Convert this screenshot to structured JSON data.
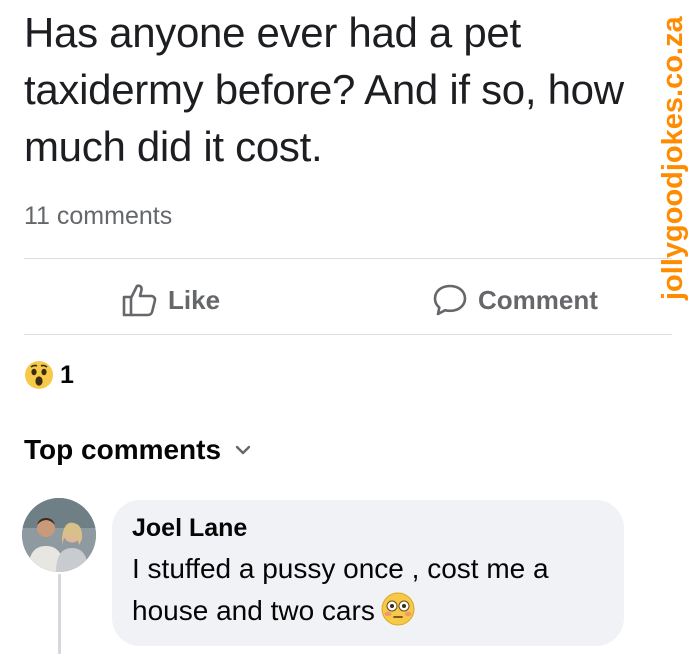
{
  "post": {
    "text": "Has anyone ever had a pet taxidermy before? And if so, how much did it cost.",
    "comments_count": "11 comments"
  },
  "actions": {
    "like_label": "Like",
    "comment_label": "Comment"
  },
  "reactions": {
    "count": "1",
    "emoji": "wow-face"
  },
  "comments_section": {
    "sort_label": "Top comments"
  },
  "comment": {
    "author": "Joel Lane",
    "text": "I stuffed a pussy once , cost me a house and two cars",
    "emoji": "flushed-face"
  },
  "watermark": {
    "text": "jollygoodjokes.co.za"
  },
  "colors": {
    "primary_text": "#050505",
    "secondary_text": "#65676b",
    "bubble_bg": "#f0f2f5",
    "watermark": "#ff8c00",
    "divider": "#dadde1"
  }
}
